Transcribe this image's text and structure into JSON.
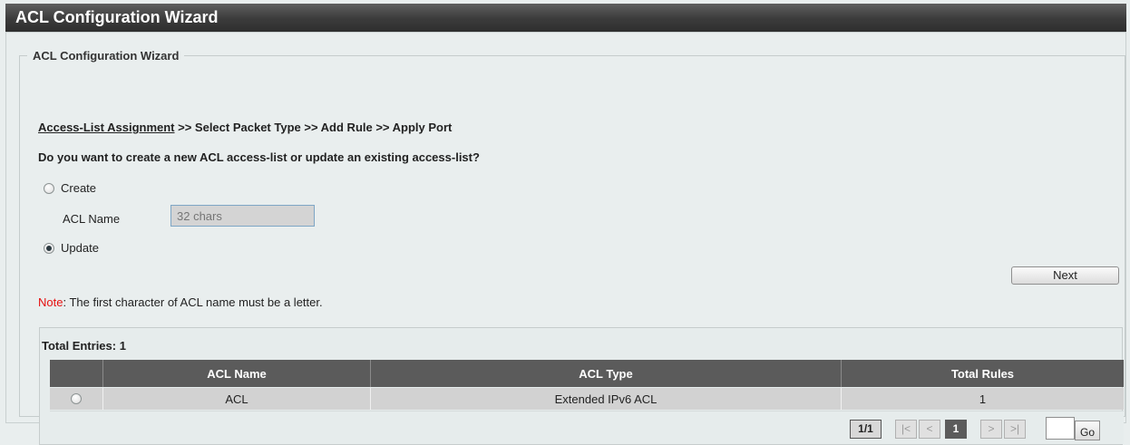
{
  "window": {
    "title": "ACL Configuration Wizard"
  },
  "wizard": {
    "legend": "ACL Configuration Wizard",
    "breadcrumb": {
      "current": "Access-List Assignment",
      "rest": " >> Select Packet Type >> Add Rule >> Apply Port"
    },
    "question": "Do you want to create a new ACL access-list or update an existing access-list?",
    "options": {
      "create_label": "Create",
      "update_label": "Update",
      "selected": "Update"
    },
    "acl_name": {
      "label": "ACL Name",
      "placeholder": "32 chars",
      "value": ""
    },
    "next_label": "Next",
    "note": {
      "label": "Note",
      "text": ":  The first character of ACL name must be a letter."
    }
  },
  "table": {
    "total_entries": "Total Entries: 1",
    "columns": [
      "",
      "ACL Name",
      "ACL Type",
      "Total Rules"
    ],
    "rows": [
      {
        "acl_name": "ACL",
        "acl_type": "Extended IPv6 ACL",
        "total_rules": "1"
      }
    ]
  },
  "pager": {
    "count": "1/1",
    "first": "|<",
    "prev": "<",
    "current": "1",
    "next": ">",
    "last": ">|",
    "go_label": "Go"
  }
}
